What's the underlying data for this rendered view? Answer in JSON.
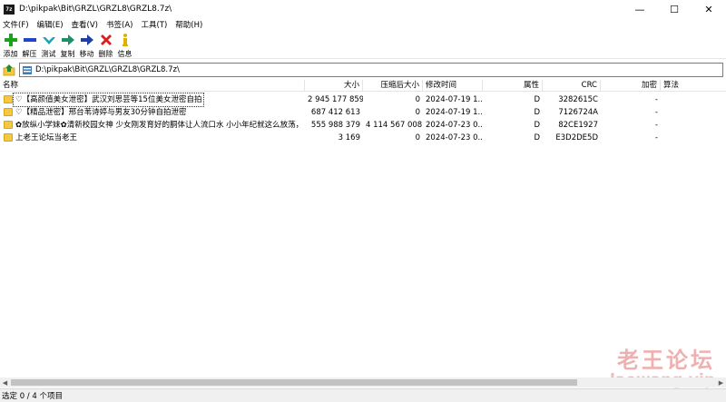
{
  "window": {
    "title": "D:\\pikpak\\Bit\\GRZL\\GRZL8\\GRZL8.7z\\",
    "app_icon_text": "7z",
    "minimize_glyph": "—",
    "maximize_glyph": "☐",
    "close_glyph": "✕"
  },
  "menu": [
    "文件(F)",
    "编辑(E)",
    "查看(V)",
    "书签(A)",
    "工具(T)",
    "帮助(H)"
  ],
  "toolbar": {
    "add": "添加",
    "extract": "解压",
    "test": "测试",
    "copy": "复制",
    "move": "移动",
    "delete": "删除",
    "info": "信息"
  },
  "colors": {
    "add": "#1ea11e",
    "extract": "#2443c9",
    "test": "#18a3b8",
    "copy": "#1d8f6a",
    "move": "#1f3fa8",
    "delete": "#d81e1e",
    "info": "#e0b000"
  },
  "address": {
    "path": "D:\\pikpak\\Bit\\GRZL\\GRZL8\\GRZL8.7z\\"
  },
  "columns": {
    "name": "名称",
    "size": "大小",
    "packed": "压缩后大小",
    "modified": "修改时间",
    "attr": "属性",
    "crc": "CRC",
    "encrypted": "加密",
    "method": "算法"
  },
  "rows": [
    {
      "name": "♡【高颜值美女泄密】武汉刘思芸等15位美女泄密自拍",
      "size": "2 945 177 859",
      "packed": "0",
      "modified": "2024-07-19 1...",
      "attr": "D",
      "crc": "3282615C",
      "encrypted": "-"
    },
    {
      "name": "♡【精品泄密】邢台苇诗婷与男友30分钟自拍泄密",
      "size": "687 412 613",
      "packed": "0",
      "modified": "2024-07-19 1...",
      "attr": "D",
      "crc": "7126724A",
      "encrypted": "-"
    },
    {
      "name": "✿放纵小学妹✿清新校园女神 少女刚发育好的胴体让人流口水 小小年纪就这么放荡，以后...",
      "size": "555 988 379",
      "packed": "4 114 567 008",
      "modified": "2024-07-23 0...",
      "attr": "D",
      "crc": "82CE1927",
      "encrypted": "-"
    },
    {
      "name": "上老王论坛当老王",
      "size": "3 169",
      "packed": "0",
      "modified": "2024-07-23 0...",
      "attr": "D",
      "crc": "E3D2DE5D",
      "encrypted": "-"
    }
  ],
  "status": {
    "text": "选定 0 / 4 个项目"
  },
  "watermark": {
    "cn": "老王论坛",
    "en": "laowang.vip"
  }
}
